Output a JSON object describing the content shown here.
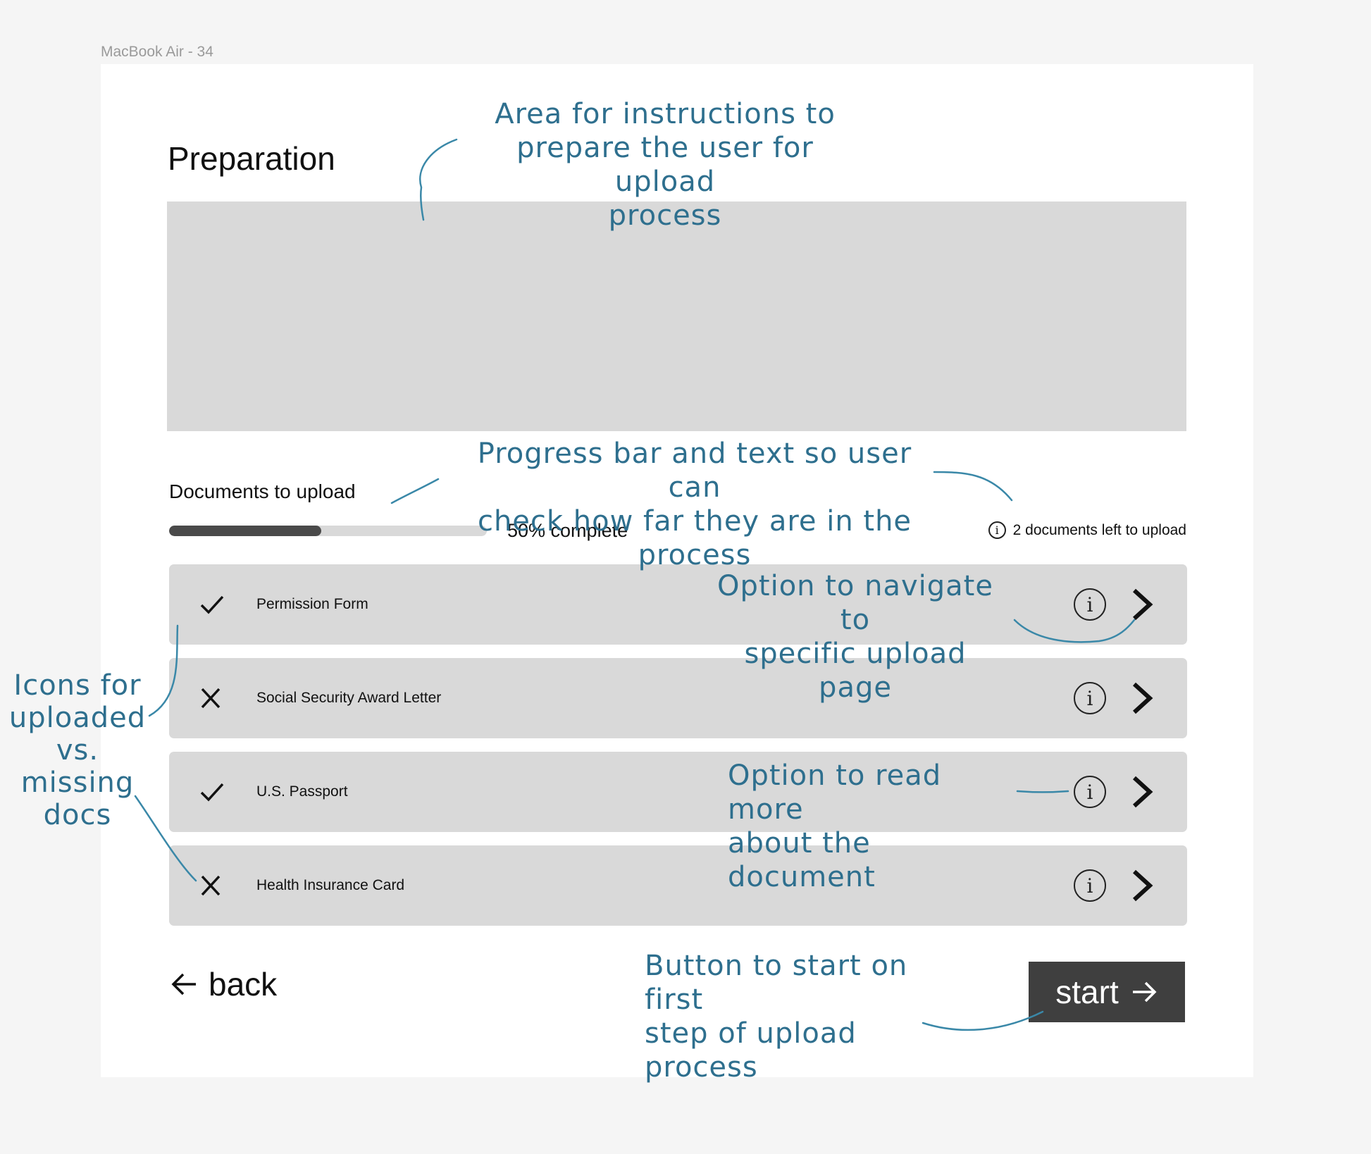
{
  "frame_label": "MacBook Air - 34",
  "page_title": "Preparation",
  "documents": {
    "heading": "Documents to upload",
    "progress_fraction": 0.48,
    "progress_text": "50% complete",
    "remaining_text": "2 documents left to upload",
    "items": [
      {
        "label": "Permission Form",
        "status": "uploaded"
      },
      {
        "label": "Social Security Award Letter",
        "status": "missing"
      },
      {
        "label": "U.S. Passport",
        "status": "uploaded"
      },
      {
        "label": "Health Insurance Card",
        "status": "missing"
      }
    ]
  },
  "info_glyph": "i",
  "back_label": "back",
  "start_label": "start",
  "annotations": {
    "instructions": [
      "Area for instructions to",
      "prepare the user for upload",
      "process"
    ],
    "progress": [
      "Progress bar and text so user can",
      "check how far they are in the",
      "process"
    ],
    "navigate": [
      "Option to navigate to",
      "specific upload page"
    ],
    "icons": [
      "Icons for",
      "uploaded",
      "vs.",
      "missing",
      "docs"
    ],
    "read_more": [
      "Option to read more",
      "about the document"
    ],
    "start": [
      "Button to start on first",
      "step of upload process"
    ]
  },
  "colors": {
    "annotation": "#2e6f8e",
    "panel": "#d9d9d9",
    "button": "#3f3f3f"
  }
}
